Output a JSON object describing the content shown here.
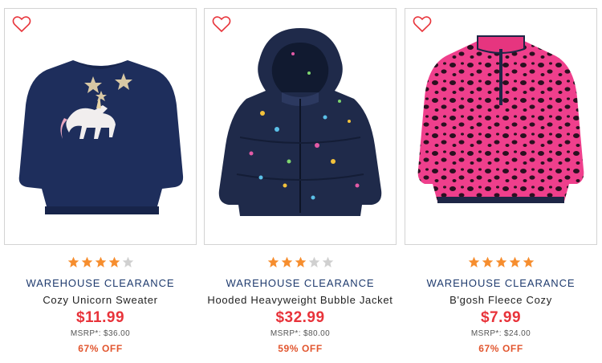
{
  "colors": {
    "star_filled": "#f68d2e",
    "star_empty": "#d0d0d0",
    "heart": "#e8333a",
    "brand": "#1f3b6e",
    "price": "#e8333a",
    "discount": "#e2562f"
  },
  "products": [
    {
      "rating": 4,
      "brand": "WAREHOUSE CLEARANCE",
      "name": "Cozy Unicorn Sweater",
      "price": "$11.99",
      "msrp": "MSRP*: $36.00",
      "discount": "67% OFF"
    },
    {
      "rating": 3,
      "brand": "WAREHOUSE CLEARANCE",
      "name": "Hooded Heavyweight Bubble Jacket",
      "price": "$32.99",
      "msrp": "MSRP*: $80.00",
      "discount": "59% OFF"
    },
    {
      "rating": 5,
      "brand": "WAREHOUSE CLEARANCE",
      "name": "B'gosh Fleece Cozy",
      "price": "$7.99",
      "msrp": "MSRP*: $24.00",
      "discount": "67% OFF"
    }
  ]
}
